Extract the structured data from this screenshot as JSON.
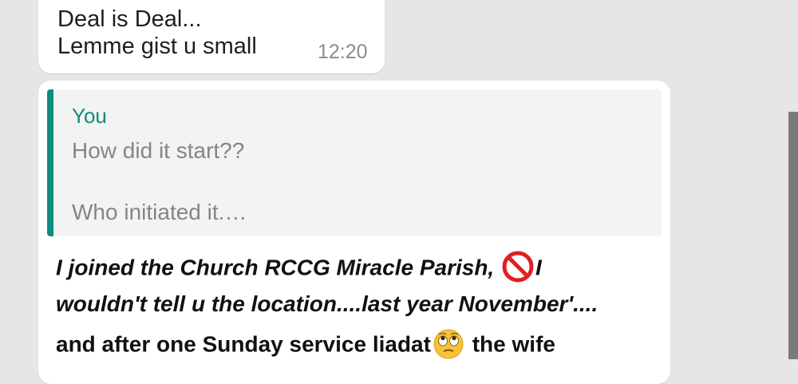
{
  "messages": [
    {
      "lines": [
        "Deal is Deal...",
        "Lemme gist u small"
      ],
      "time": "12:20"
    },
    {
      "quote": {
        "sender": "You",
        "lines": [
          "How did it start??",
          "Who initiated it.…"
        ]
      },
      "line1_a": "I joined the Church RCCG Miracle Parish, ",
      "line1_b": "I",
      "line2": "wouldn't tell u the location....last year November'....",
      "line3_a": "and after one Sunday service liadat",
      "line3_b": " the wife"
    }
  ],
  "icons": {
    "prohibited": "prohibited-emoji-icon",
    "eye_roll": "face-with-rolling-eyes-emoji-icon"
  },
  "colors": {
    "background": "#e6e6e6",
    "bubble": "#ffffff",
    "quote_accent": "#0e8b7b",
    "quote_bg": "#f3f3f3",
    "prohibited_red": "#e02020",
    "emoji_yellow": "#f7c23a"
  }
}
